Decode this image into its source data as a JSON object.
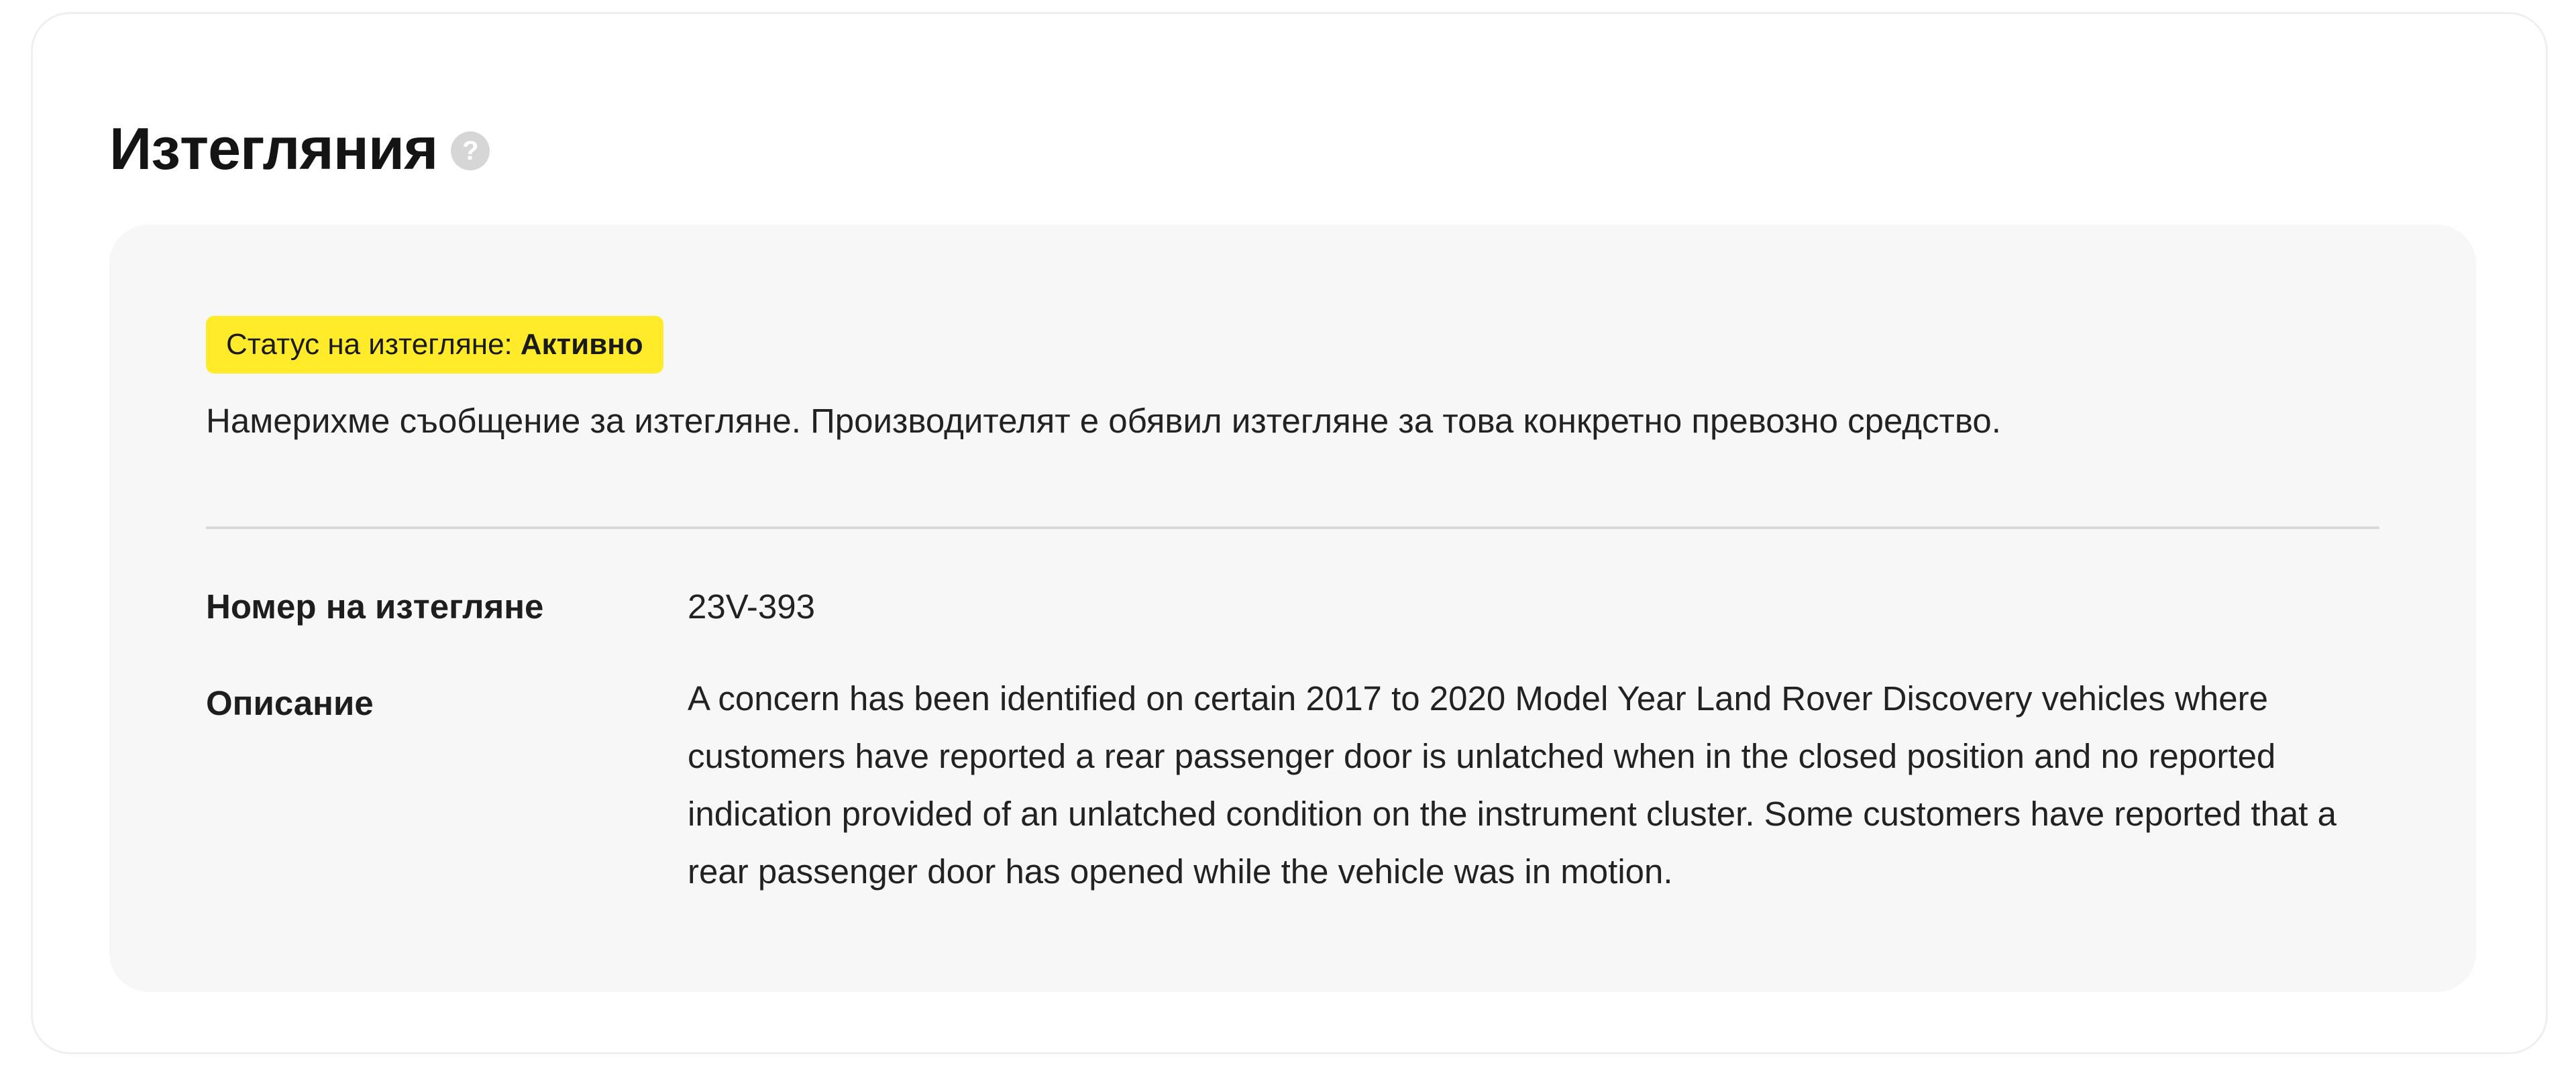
{
  "section": {
    "title": "Изтегляния",
    "help_icon_glyph": "?"
  },
  "status": {
    "label": "Статус на изтегляне:",
    "value": "Активно",
    "badge_color": "#ffeb2a"
  },
  "message": "Намерихме съобщение за изтегляне. Производителят е обявил изтегляне за това конкретно превозно средство.",
  "details": {
    "recall_number_label": "Номер на изтегляне",
    "recall_number_value": "23V-393",
    "description_label": "Описание",
    "description_value": "A concern has been identified on certain 2017 to 2020 Model Year Land Rover Discovery vehicles where customers have reported a rear passenger door is unlatched when in the closed position and no reported indication provided of an unlatched condition on the instrument cluster. Some customers have reported that a rear passenger door has opened while the vehicle was in motion."
  }
}
